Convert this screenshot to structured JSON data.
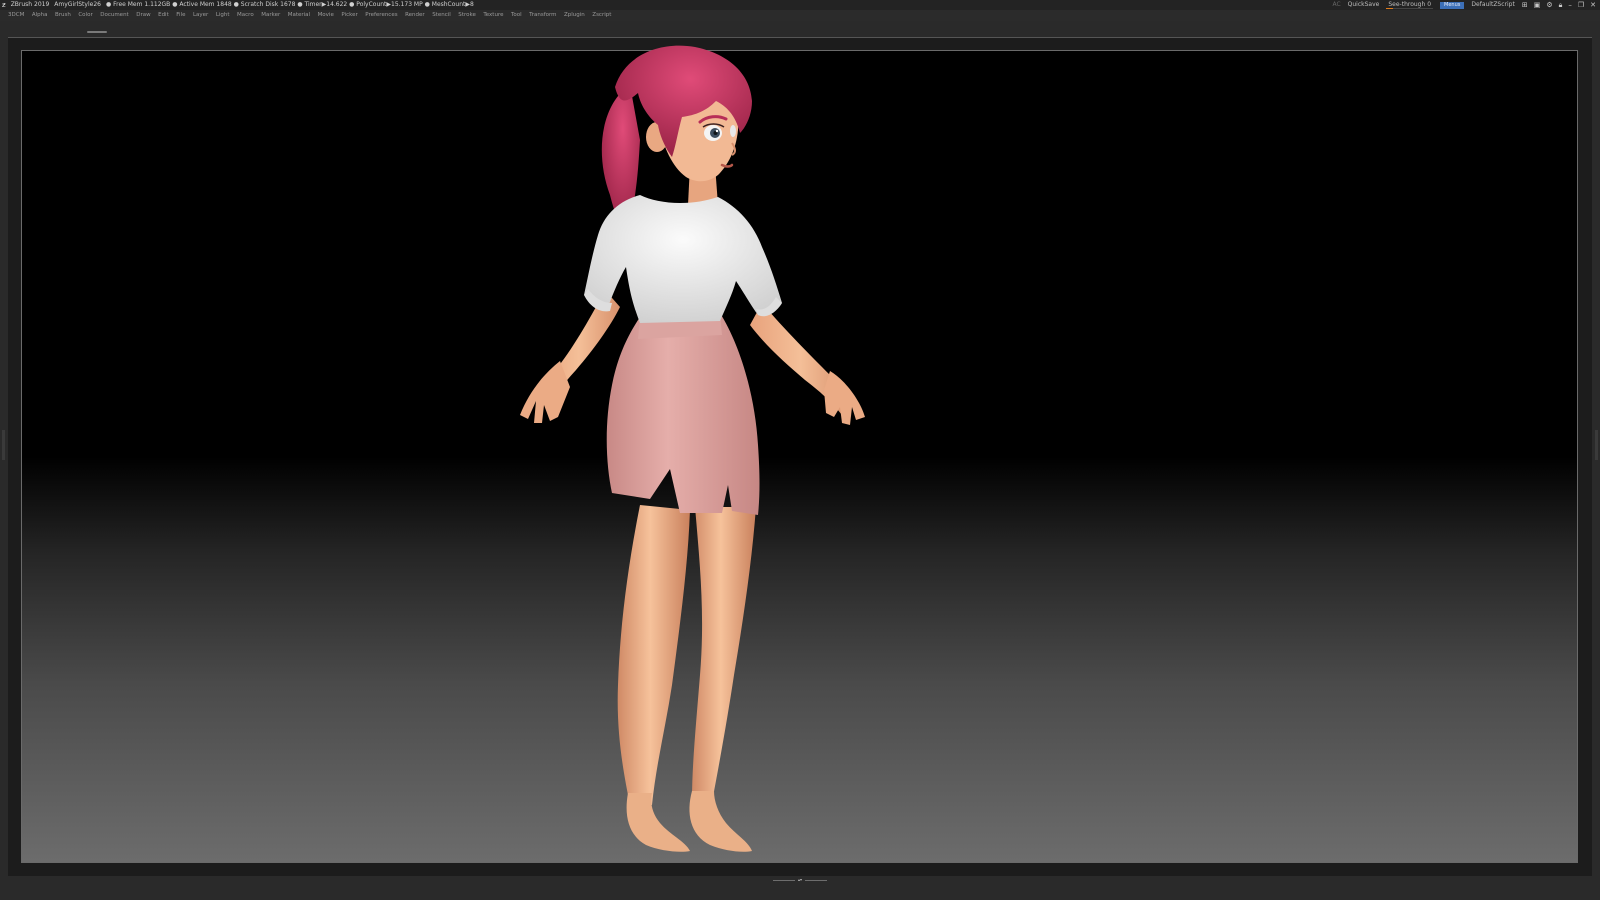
{
  "titlebar": {
    "app": "ZBrush 2019",
    "document": "AmyGirlStyle26",
    "stats": "● Free Mem 1.112GB ● Active Mem 1848 ● Scratch Disk 1678 ● Timer▶14.622 ● PolyCount▶15.173 MP ● MeshCount▶8",
    "ac": "AC",
    "quicksave": "QuickSave",
    "see_through_label": "See-through",
    "see_through_value": "0",
    "see_through_level": 0,
    "menus_button": "Menus",
    "script": "DefaultZScript"
  },
  "menubar": {
    "items": [
      "3DCM",
      "Alpha",
      "Brush",
      "Color",
      "Document",
      "Draw",
      "Edit",
      "File",
      "Layer",
      "Light",
      "Macro",
      "Marker",
      "Material",
      "Movie",
      "Picker",
      "Preferences",
      "Render",
      "Stencil",
      "Stroke",
      "Texture",
      "Tool",
      "Transform",
      "Zplugin",
      "Zscript"
    ]
  },
  "colors": {
    "hair": "#c8345e",
    "skin": "#f0b48c",
    "shirt": "#eeeeee",
    "skirt": "#d99c99",
    "accent": "#3c6fb7",
    "see_through_bar": "#e07b1a"
  },
  "icons": [
    "zbrush-logo-icon",
    "layout-icon",
    "window-icon",
    "interface-icon",
    "lock-icon",
    "minimize-icon",
    "restore-icon",
    "close-icon"
  ]
}
